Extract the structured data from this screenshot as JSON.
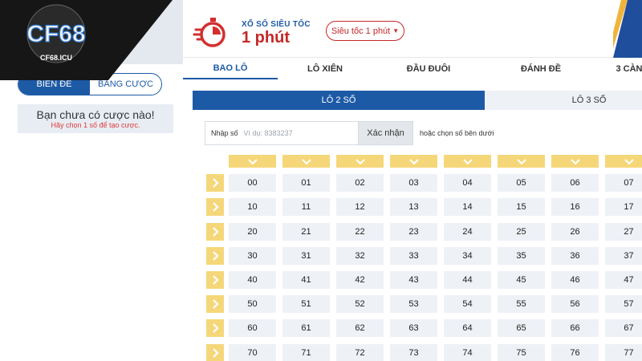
{
  "logo": {
    "text": "CF68",
    "subtitle": "CF68.ICU"
  },
  "sidebar": {
    "segments": [
      {
        "label": "BIÊN ĐỀ",
        "active": true
      },
      {
        "label": "BẢNG CƯỢC",
        "active": false
      }
    ],
    "empty_title": "Bạn chưa có cược nào!",
    "empty_hint": "Hãy chọn 1 số để tạo cược."
  },
  "header": {
    "small_title": "XỔ SỐ SIÊU TỐC",
    "big_title": "1 phút",
    "dropdown": {
      "selected": "Siêu tốc 1 phút",
      "icon": "caret-down-icon"
    }
  },
  "tabs": [
    {
      "label": "BAO LÔ",
      "active": true
    },
    {
      "label": "LÔ XIÊN",
      "active": false
    },
    {
      "label": "ĐẦU ĐUÔI",
      "active": false
    },
    {
      "label": "ĐÁNH ĐỀ",
      "active": false
    },
    {
      "label": "3 CÀN",
      "active": false
    }
  ],
  "subtabs": [
    {
      "label": "LÔ 2 SỐ",
      "active": true
    },
    {
      "label": "LÔ 3 SỐ",
      "active": false
    }
  ],
  "number_input": {
    "label": "Nhập số",
    "placeholder": "Ví dụ: 8383237",
    "confirm_label": "Xác nhận",
    "hint": "hoặc chọn số bên dưới"
  },
  "number_grid": [
    [
      "00",
      "01",
      "02",
      "03",
      "04",
      "05",
      "06",
      "07"
    ],
    [
      "10",
      "11",
      "12",
      "13",
      "14",
      "15",
      "16",
      "17"
    ],
    [
      "20",
      "21",
      "22",
      "23",
      "24",
      "25",
      "26",
      "27"
    ],
    [
      "30",
      "31",
      "32",
      "33",
      "34",
      "35",
      "36",
      "37"
    ],
    [
      "40",
      "41",
      "42",
      "43",
      "44",
      "45",
      "46",
      "47"
    ],
    [
      "50",
      "51",
      "52",
      "53",
      "54",
      "55",
      "56",
      "57"
    ],
    [
      "60",
      "61",
      "62",
      "63",
      "64",
      "65",
      "66",
      "67"
    ],
    [
      "70",
      "71",
      "72",
      "73",
      "74",
      "75",
      "76",
      "77"
    ]
  ],
  "colors": {
    "primary": "#1d5aa6",
    "accent": "#c62828",
    "selector_yellow": "#f5d77a",
    "cell_bg": "#eef1f6"
  }
}
